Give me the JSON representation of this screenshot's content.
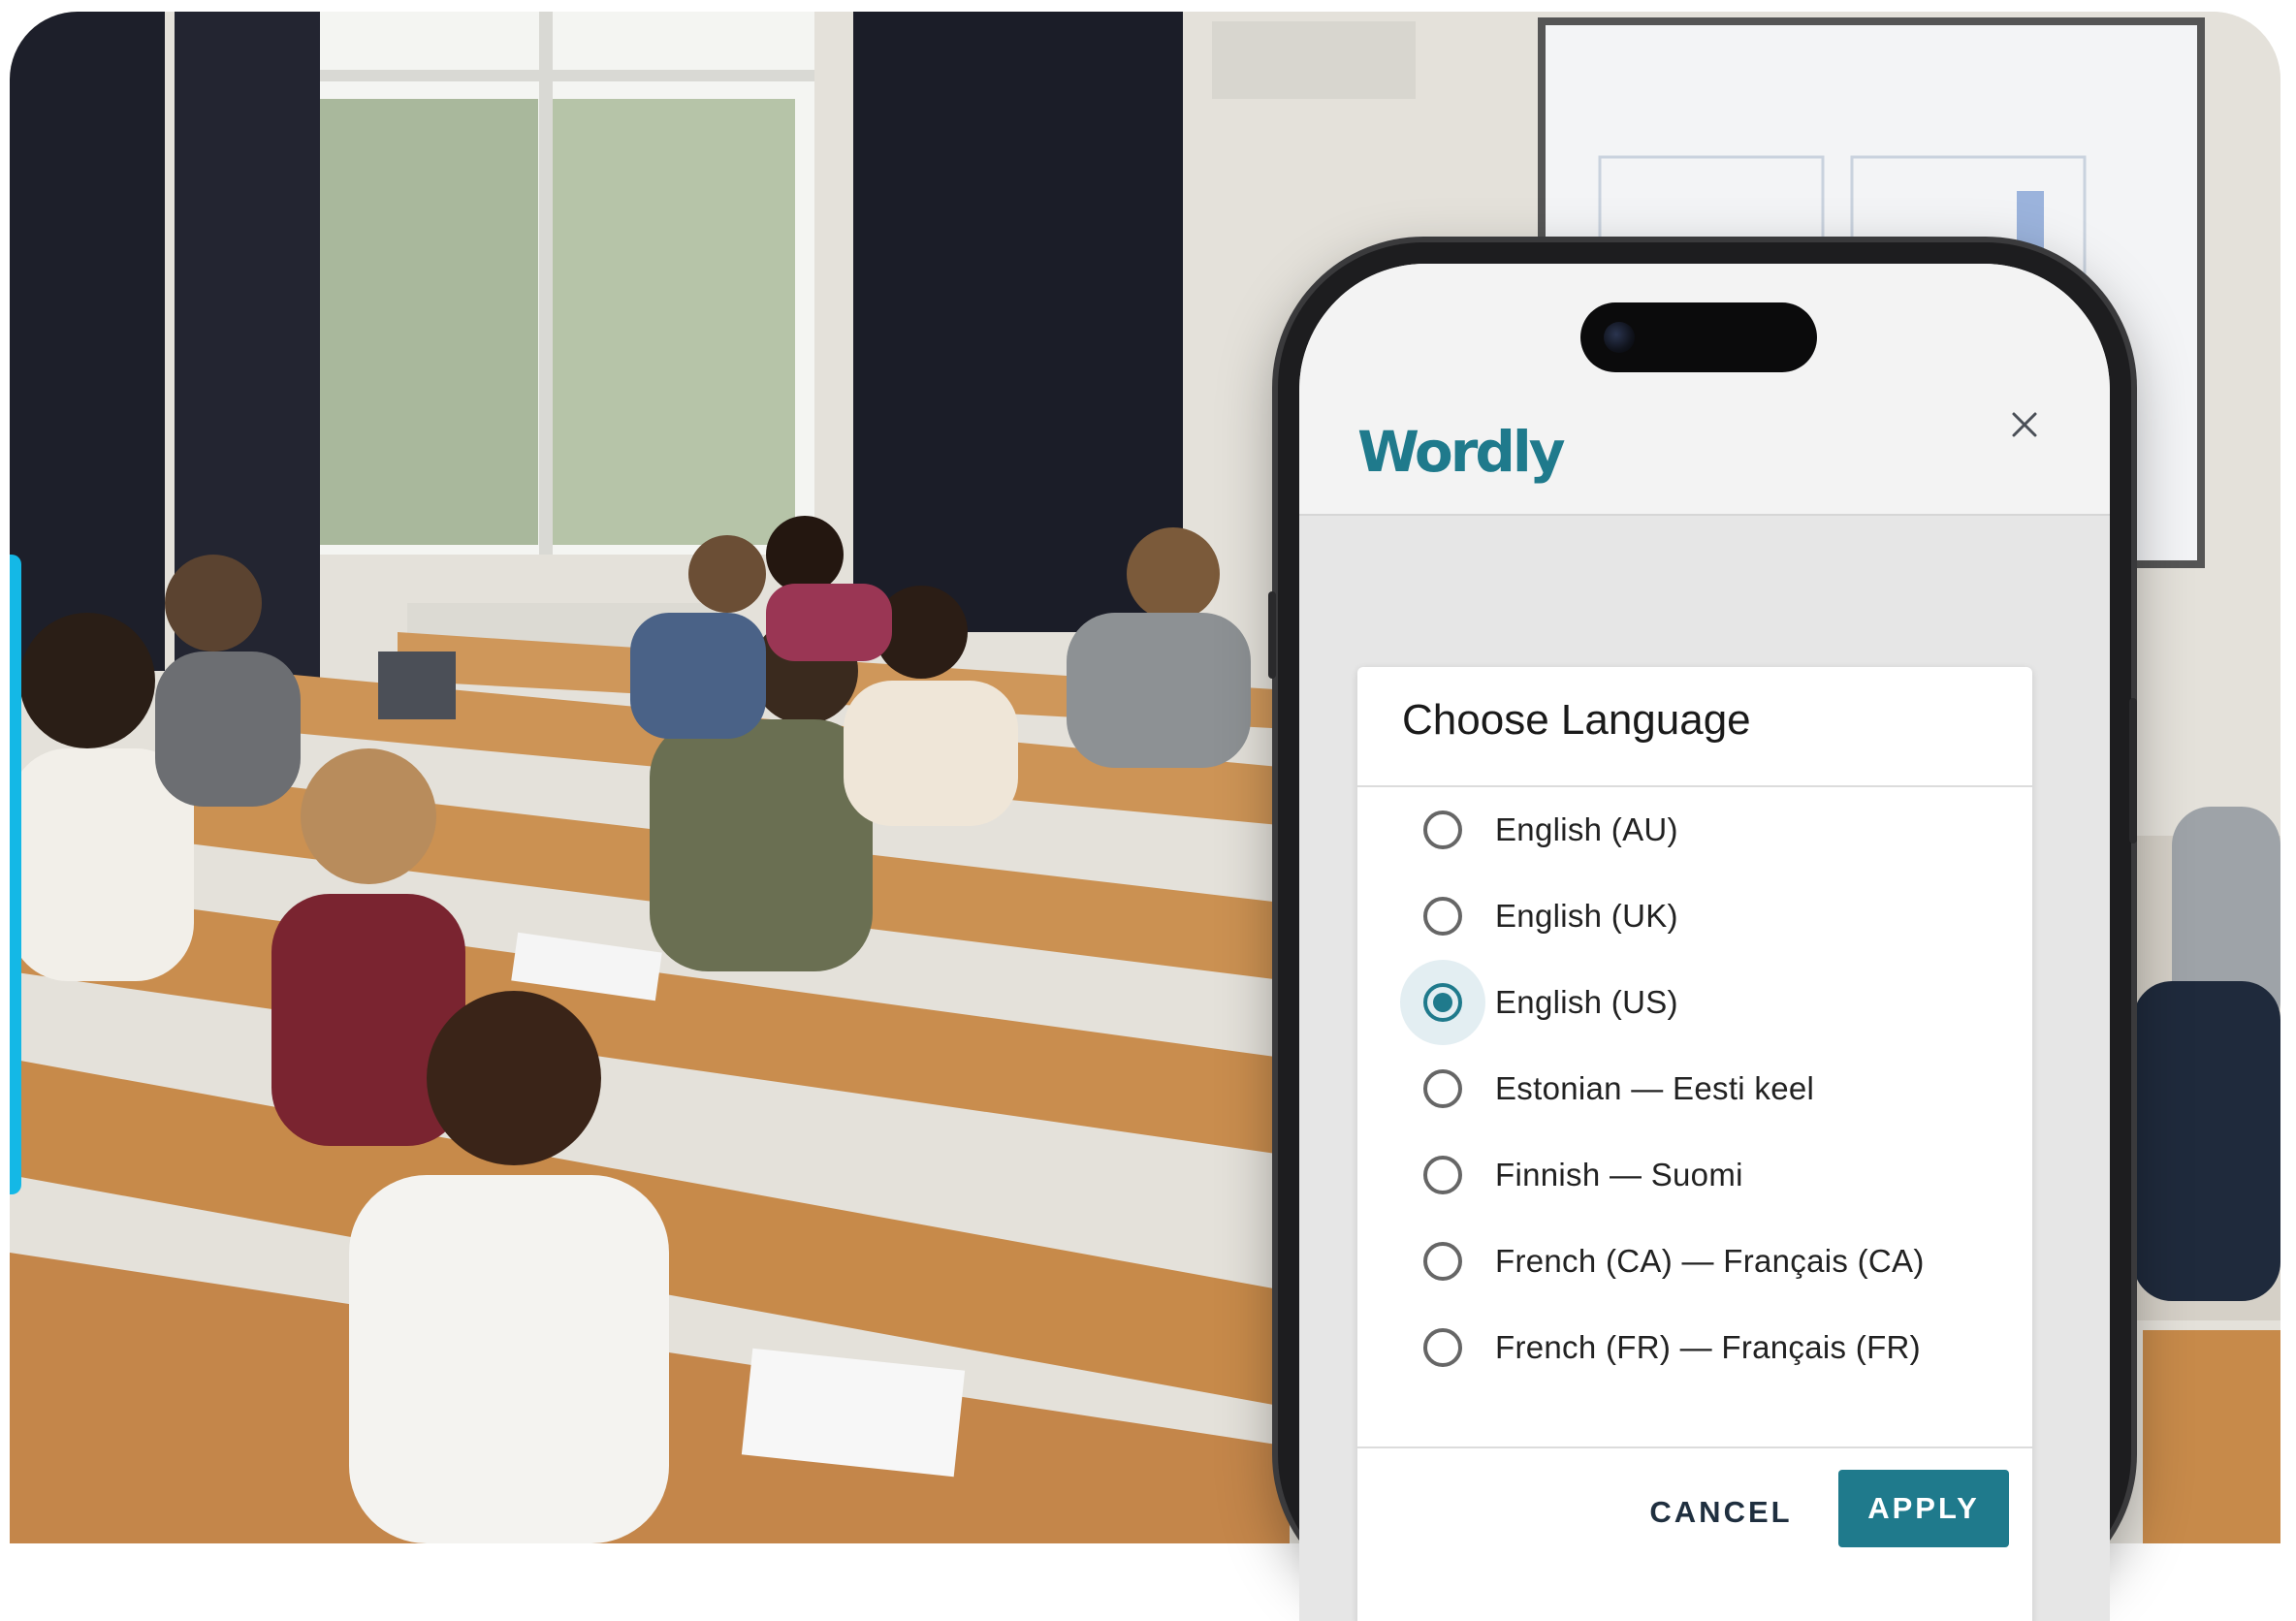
{
  "app": {
    "logo_text": "Wordly"
  },
  "icons": {
    "close": "close-icon",
    "radio": "radio-button-icon"
  },
  "colors": {
    "brand_teal": "#1f7a8c",
    "accent_cyan": "#14b8e6",
    "radio_unselected": "#666666"
  },
  "dialog": {
    "title": "Choose Language",
    "languages": [
      {
        "label": "English (AU)",
        "selected": false
      },
      {
        "label": "English (UK)",
        "selected": false
      },
      {
        "label": "English (US)",
        "selected": true
      },
      {
        "label": "Estonian — Eesti keel",
        "selected": false
      },
      {
        "label": "Finnish — Suomi",
        "selected": false
      },
      {
        "label": "French (CA) — Français (CA)",
        "selected": false
      },
      {
        "label": "French (FR) — Français (FR)",
        "selected": false
      }
    ],
    "cancel_label": "CANCEL",
    "apply_label": "APPLY"
  }
}
